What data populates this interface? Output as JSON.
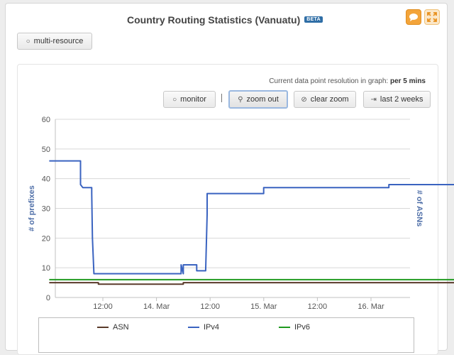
{
  "header": {
    "title": "Country Routing Statistics (Vanuatu)",
    "badge": "BETA"
  },
  "controls": {
    "multi_resource_label": "multi-resource",
    "monitor_label": "monitor",
    "separator": "|",
    "zoom_out_label": "zoom out",
    "clear_zoom_label": "clear zoom",
    "last_2_weeks_label": "last 2 weeks"
  },
  "resolution": {
    "prefix": "Current data point resolution in graph:",
    "value": "per 5 mins"
  },
  "icons": {
    "feedback": "speech-bubble-icon",
    "fullscreen": "expand-icon",
    "monitor": "circle-icon",
    "zoom_out": "magnifier-icon",
    "clear_zoom": "no-symbol-icon",
    "last_2_weeks": "arrow-to-bar-icon"
  },
  "colors": {
    "accent": "#f0a030",
    "asn": "#5a3a2a",
    "ipv4": "#3a63c0",
    "ipv6": "#1f9a1f",
    "axis_label": "#4f6fa8"
  },
  "chart_data": {
    "type": "line",
    "ylabel_left": "# of prefixes",
    "ylabel_right": "# of ASNs",
    "ylim": [
      0,
      60
    ],
    "y_ticks": [
      "0",
      "10",
      "20",
      "30",
      "40",
      "50",
      "60"
    ],
    "x_ticks": [
      "12:00",
      "14. Mar",
      "12:00",
      "15. Mar",
      "12:00",
      "16. Mar"
    ],
    "grid": true,
    "legend_placement": "bottom",
    "series": [
      {
        "name": "ASN",
        "color": "#5a3a2a",
        "points": [
          [
            "13. Mar 00:00",
            5
          ],
          [
            "13. Mar 11:00",
            5
          ],
          [
            "13. Mar 11:00",
            4.5
          ],
          [
            "14. Mar 06:00",
            4.5
          ],
          [
            "14. Mar 06:00",
            5
          ],
          [
            "16. Mar 23:59",
            5
          ]
        ]
      },
      {
        "name": "IPv4",
        "color": "#3a63c0",
        "points": [
          [
            "13. Mar 00:00",
            46
          ],
          [
            "13. Mar 07:00",
            46
          ],
          [
            "13. Mar 07:00",
            38
          ],
          [
            "13. Mar 07:30",
            37
          ],
          [
            "13. Mar 09:30",
            37
          ],
          [
            "13. Mar 09:30",
            35
          ],
          [
            "13. Mar 09:40",
            20
          ],
          [
            "13. Mar 10:00",
            8
          ],
          [
            "14. Mar 05:30",
            8
          ],
          [
            "14. Mar 05:30",
            11
          ],
          [
            "14. Mar 06:00",
            8
          ],
          [
            "14. Mar 06:00",
            11
          ],
          [
            "14. Mar 09:00",
            11
          ],
          [
            "14. Mar 09:00",
            9
          ],
          [
            "14. Mar 11:00",
            9
          ],
          [
            "14. Mar 11:20",
            28
          ],
          [
            "14. Mar 11:20",
            35
          ],
          [
            "14. Mar 23:59",
            35
          ],
          [
            "14. Mar 23:59",
            37
          ],
          [
            "16. Mar 04:00",
            37
          ],
          [
            "16. Mar 04:00",
            38
          ],
          [
            "16. Mar 23:59",
            38
          ]
        ]
      },
      {
        "name": "IPv6",
        "color": "#1f9a1f",
        "points": [
          [
            "13. Mar 00:00",
            6
          ],
          [
            "16. Mar 23:59",
            6
          ]
        ]
      }
    ]
  }
}
